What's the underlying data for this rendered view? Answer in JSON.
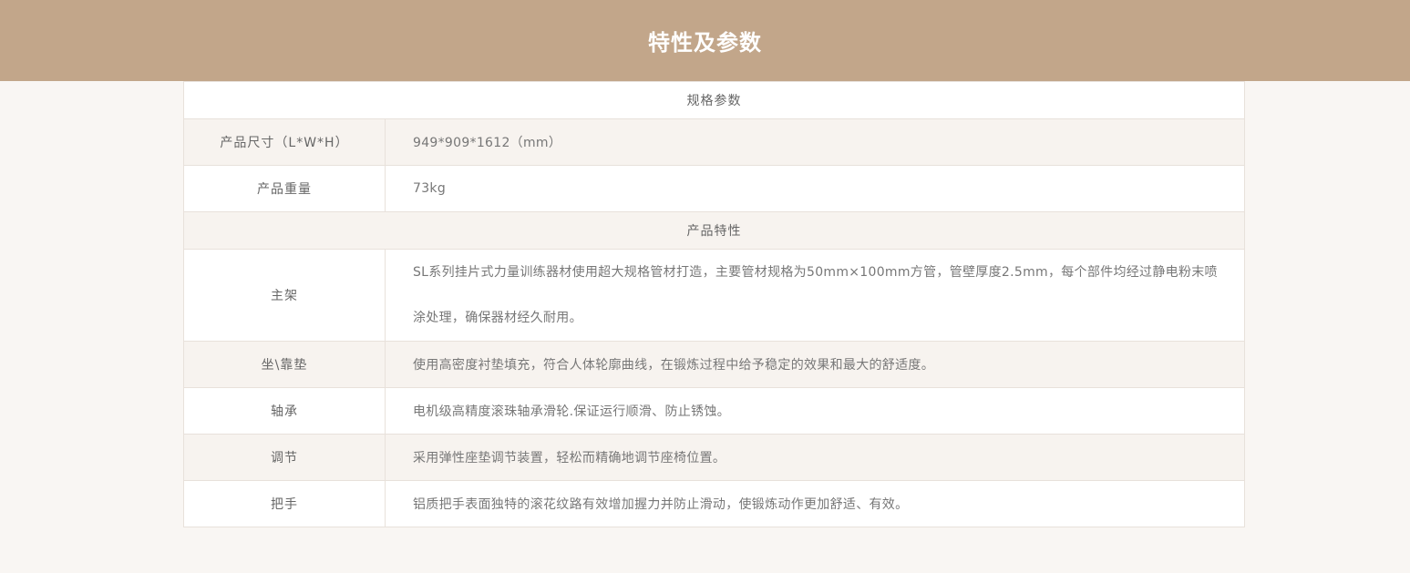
{
  "header": {
    "title": "特性及参数"
  },
  "spec_section": {
    "title": "规格参数",
    "rows": [
      {
        "label": "产品尺寸（L*W*H）",
        "value": "949*909*1612（mm）"
      },
      {
        "label": "产品重量",
        "value": "73kg"
      }
    ]
  },
  "features_section": {
    "title": "产品特性",
    "rows": [
      {
        "label": "主架",
        "value": "SL系列挂片式力量训练器材使用超大规格管材打造，主要管材规格为50mm×100mm方管，管壁厚度2.5mm，每个部件均经过静电粉末喷涂处理，确保器材经久耐用。"
      },
      {
        "label": "坐\\靠垫",
        "value": "使用高密度衬垫填充，符合人体轮廓曲线，在锻炼过程中给予稳定的效果和最大的舒适度。"
      },
      {
        "label": "轴承",
        "value": "电机级高精度滚珠轴承滑轮.保证运行顺滑、防止锈蚀。"
      },
      {
        "label": "调节",
        "value": "采用弹性座垫调节装置，轻松而精确地调节座椅位置。"
      },
      {
        "label": "把手",
        "value": "铝质把手表面独特的滚花纹路有效增加握力并防止滑动，使锻炼动作更加舒适、有效。"
      }
    ]
  },
  "colors": {
    "header_bg": "#c2a68a",
    "page_bg": "#f9f6f3",
    "row_shade": "#f7f3ef",
    "border": "#e8e1db"
  }
}
